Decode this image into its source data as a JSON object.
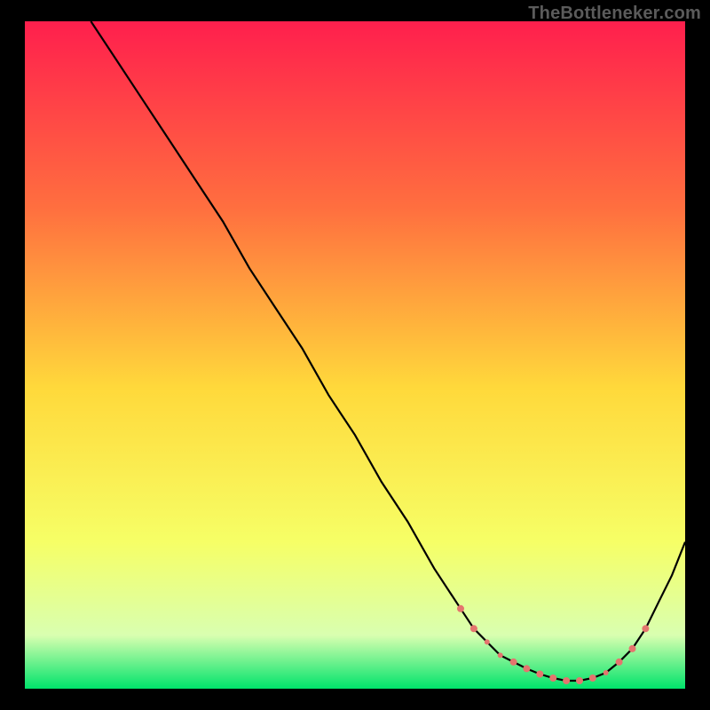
{
  "watermark": "TheBottleneker.com",
  "colors": {
    "gradient_top": "#ff1f4d",
    "gradient_mid_upper": "#ff6f3f",
    "gradient_mid": "#ffd93b",
    "gradient_mid_lower": "#f6ff66",
    "gradient_lower": "#d9ffb0",
    "gradient_bottom": "#00e36b",
    "curve": "#000000",
    "marker": "#e4756e",
    "frame": "#000000"
  },
  "chart_data": {
    "type": "line",
    "title": "",
    "xlabel": "",
    "ylabel": "",
    "xlim": [
      0,
      100
    ],
    "ylim": [
      0,
      100
    ],
    "series": [
      {
        "name": "bottleneck-curve",
        "x": [
          10,
          14,
          18,
          22,
          26,
          30,
          34,
          38,
          42,
          46,
          50,
          54,
          58,
          62,
          66,
          68,
          70,
          72,
          74,
          76,
          78,
          80,
          82,
          84,
          86,
          88,
          90,
          92,
          94,
          96,
          98,
          100
        ],
        "y": [
          100,
          94,
          88,
          82,
          76,
          70,
          63,
          57,
          51,
          44,
          38,
          31,
          25,
          18,
          12,
          9,
          7,
          5,
          4,
          3,
          2.2,
          1.6,
          1.2,
          1.2,
          1.6,
          2.4,
          4,
          6,
          9,
          13,
          17,
          22
        ]
      }
    ],
    "markers": {
      "name": "highlighted-range",
      "points": [
        {
          "x": 66,
          "y": 12,
          "r": 4
        },
        {
          "x": 68,
          "y": 9,
          "r": 4
        },
        {
          "x": 70,
          "y": 7,
          "r": 3
        },
        {
          "x": 72,
          "y": 5,
          "r": 3
        },
        {
          "x": 74,
          "y": 4,
          "r": 4
        },
        {
          "x": 76,
          "y": 3,
          "r": 4
        },
        {
          "x": 78,
          "y": 2.2,
          "r": 4
        },
        {
          "x": 80,
          "y": 1.6,
          "r": 4
        },
        {
          "x": 82,
          "y": 1.2,
          "r": 4
        },
        {
          "x": 84,
          "y": 1.2,
          "r": 4
        },
        {
          "x": 86,
          "y": 1.6,
          "r": 4
        },
        {
          "x": 88,
          "y": 2.4,
          "r": 3
        },
        {
          "x": 90,
          "y": 4,
          "r": 4
        },
        {
          "x": 92,
          "y": 6,
          "r": 4
        },
        {
          "x": 94,
          "y": 9,
          "r": 4
        }
      ]
    }
  }
}
